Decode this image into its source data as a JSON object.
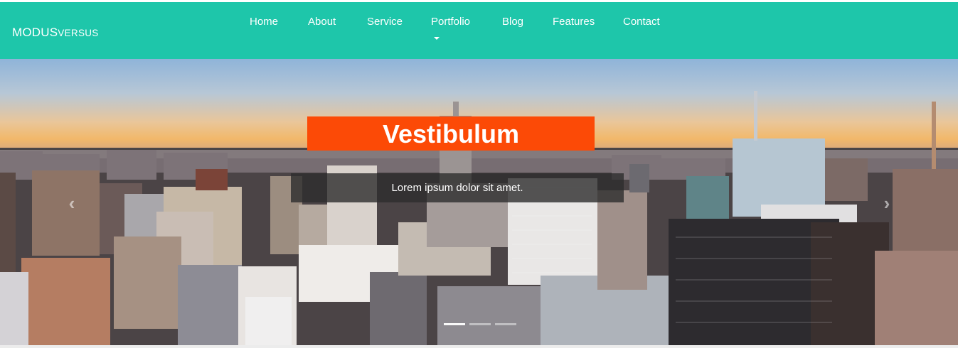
{
  "brand": {
    "part1": "MODUS",
    "part2": "VERSUS"
  },
  "nav": {
    "items": [
      {
        "label": "Home"
      },
      {
        "label": "About"
      },
      {
        "label": "Service"
      },
      {
        "label": "Portfolio"
      },
      {
        "label": "Blog"
      },
      {
        "label": "Features"
      },
      {
        "label": "Contact"
      }
    ]
  },
  "carousel": {
    "slide_title": "Vestibulum",
    "slide_caption": "Lorem ipsum dolor sit amet.",
    "prev_icon": "chevron-left-icon",
    "next_icon": "chevron-right-icon",
    "indicator_count": 3,
    "active_indicator": 0
  },
  "colors": {
    "navbar_bg": "#1ec6aa",
    "title_bg": "#fc4a06",
    "caption_bg": "#2d2d2d"
  }
}
